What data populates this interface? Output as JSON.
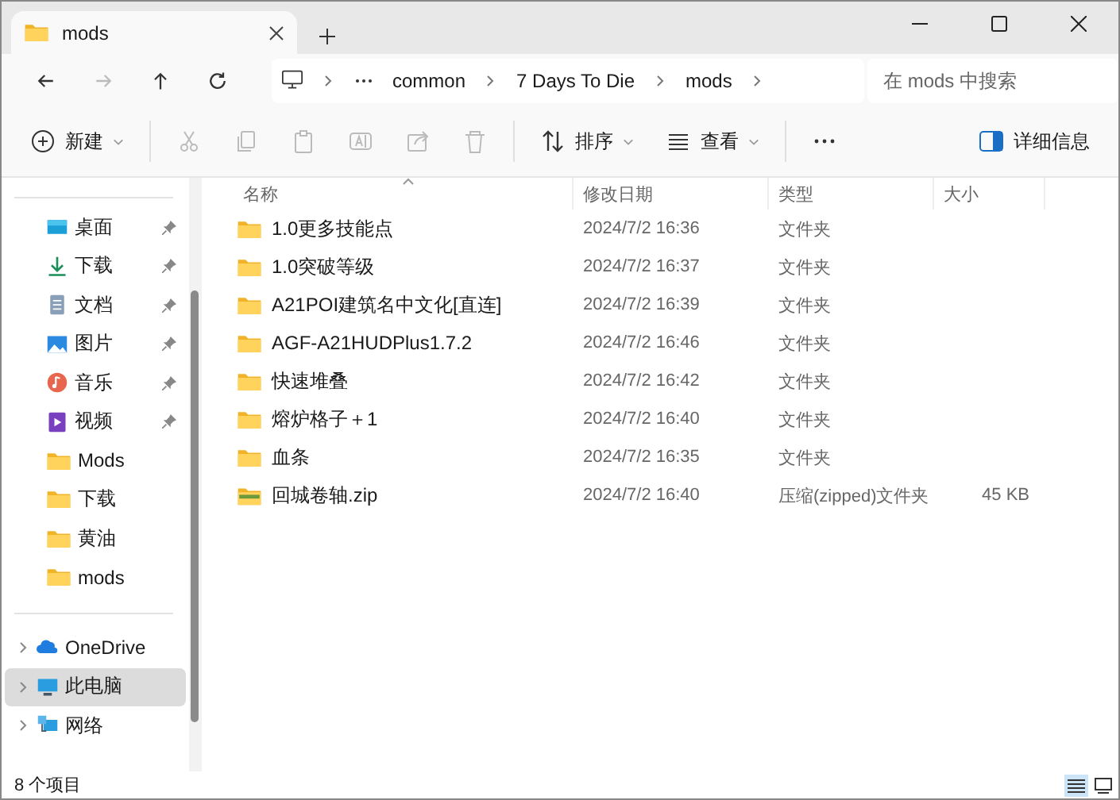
{
  "tab": {
    "title": "mods",
    "selected": true
  },
  "nav": [
    {
      "kind": "back",
      "disabled": false
    },
    {
      "kind": "forward",
      "disabled": true
    },
    {
      "kind": "up",
      "disabled": false
    },
    {
      "kind": "refresh",
      "disabled": false
    }
  ],
  "breadcrumb": [
    "common",
    "7 Days To Die",
    "mods"
  ],
  "search": {
    "placeholder": "在 mods 中搜索"
  },
  "toolbar": [
    {
      "kind": "new",
      "label": "新建",
      "disabled": false
    },
    {
      "kind": "cut",
      "disabled": true
    },
    {
      "kind": "copy",
      "disabled": true
    },
    {
      "kind": "paste",
      "disabled": true
    },
    {
      "kind": "rename",
      "disabled": true
    },
    {
      "kind": "share",
      "disabled": true
    },
    {
      "kind": "delete",
      "disabled": true
    },
    {
      "kind": "sort",
      "label": "排序",
      "disabled": false
    },
    {
      "kind": "view",
      "label": "查看",
      "disabled": false
    },
    {
      "kind": "more",
      "disabled": false
    }
  ],
  "details_button": "详细信息",
  "sidebar": {
    "quick_access": [
      {
        "kind": "desktop",
        "label": "桌面",
        "pinned": true,
        "selected": false
      },
      {
        "kind": "download",
        "label": "下载",
        "pinned": true,
        "selected": false
      },
      {
        "kind": "documents",
        "label": "文档",
        "pinned": true,
        "selected": false
      },
      {
        "kind": "pictures",
        "label": "图片",
        "pinned": true,
        "selected": false
      },
      {
        "kind": "music",
        "label": "音乐",
        "pinned": true,
        "selected": false
      },
      {
        "kind": "videos",
        "label": "视频",
        "pinned": true,
        "selected": false
      },
      {
        "kind": "folder",
        "label": "Mods",
        "pinned": false,
        "selected": false
      },
      {
        "kind": "folder",
        "label": "下载",
        "pinned": false,
        "selected": false
      },
      {
        "kind": "folder",
        "label": "黄油",
        "pinned": false,
        "selected": false
      },
      {
        "kind": "folder",
        "label": "mods",
        "pinned": false,
        "selected": false
      }
    ],
    "locations": [
      {
        "kind": "onedrive",
        "label": "OneDrive",
        "expanded": false,
        "selected": false
      },
      {
        "kind": "pc",
        "label": "此电脑",
        "expanded": false,
        "selected": true
      },
      {
        "kind": "network",
        "label": "网络",
        "expanded": false,
        "selected": false
      }
    ]
  },
  "table": {
    "columns": [
      "名称",
      "修改日期",
      "类型",
      "大小"
    ],
    "rows": [
      {
        "kind": "folder",
        "name": "1.0更多技能点",
        "modified": "2024/7/2 16:36",
        "type": "文件夹"
      },
      {
        "kind": "folder",
        "name": "1.0突破等级",
        "modified": "2024/7/2 16:37",
        "type": "文件夹"
      },
      {
        "kind": "folder",
        "name": "A21POI建筑名中文化[直连]",
        "modified": "2024/7/2 16:39",
        "type": "文件夹"
      },
      {
        "kind": "folder",
        "name": "AGF-A21HUDPlus1.7.2",
        "modified": "2024/7/2 16:46",
        "type": "文件夹"
      },
      {
        "kind": "folder",
        "name": "快速堆叠",
        "modified": "2024/7/2 16:42",
        "type": "文件夹"
      },
      {
        "kind": "folder",
        "name": "熔炉格子＋1",
        "modified": "2024/7/2 16:40",
        "type": "文件夹"
      },
      {
        "kind": "folder",
        "name": "血条",
        "modified": "2024/7/2 16:35",
        "type": "文件夹"
      },
      {
        "kind": "zip",
        "name": "回城卷轴.zip",
        "modified": "2024/7/2 16:40",
        "type": "压缩(zipped)文件夹",
        "size": "45 KB"
      }
    ]
  },
  "status_bar": {
    "count": "8 个项目",
    "views": [
      {
        "kind": "details",
        "selected": true
      },
      {
        "kind": "tiles",
        "selected": false
      }
    ]
  }
}
